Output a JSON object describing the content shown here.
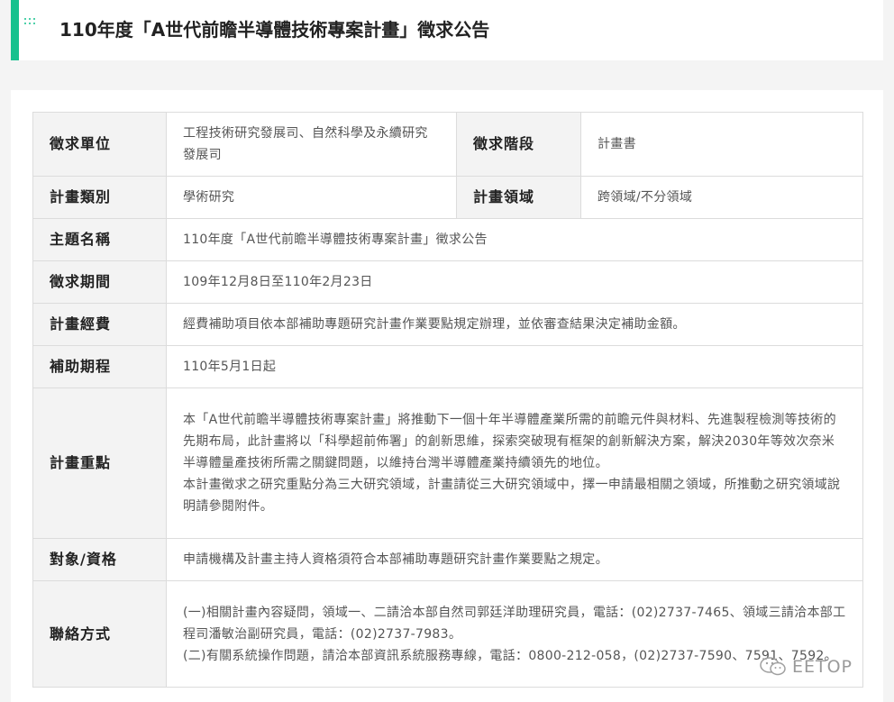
{
  "header": {
    "title": "110年度「A世代前瞻半導體技術專案計畫」徵求公告",
    "accent_color": "#16c18e",
    "icon": "dots-grid-icon"
  },
  "table": {
    "unit_label": "徵求單位",
    "unit_value": "工程技術研究發展司、自然科學及永續研究發展司",
    "stage_label": "徵求階段",
    "stage_value": "計畫書",
    "category_label": "計畫類別",
    "category_value": "學術研究",
    "field_label": "計畫領域",
    "field_value": "跨領域/不分領域",
    "topic_label": "主題名稱",
    "topic_value": "110年度「A世代前瞻半導體技術專案計畫」徵求公告",
    "period_label": "徵求期間",
    "period_value": "109年12月8日至110年2月23日",
    "budget_label": "計畫經費",
    "budget_value": "經費補助項目依本部補助專題研究計畫作業要點規定辦理，並依審查結果決定補助金額。",
    "term_label": "補助期程",
    "term_value": "110年5月1日起",
    "focus_label": "計畫重點",
    "focus_p1": "本「A世代前瞻半導體技術專案計畫」將推動下一個十年半導體產業所需的前瞻元件與材料、先進製程檢測等技術的先期布局，此計畫將以「科學超前佈署」的創新思維，探索突破現有框架的創新解決方案，解決2030年等效次奈米半導體量產技術所需之關鍵問題，以維持台灣半導體產業持續領先的地位。",
    "focus_p2": "本計畫徵求之研究重點分為三大研究領域，計畫請從三大研究領域中，擇一申請最相關之領域，所推動之研究領域說明請參閱附件。",
    "eligibility_label": "對象/資格",
    "eligibility_value": "申請機構及計畫主持人資格須符合本部補助專題研究計畫作業要點之規定。",
    "contact_label": "聯絡方式",
    "contact_p1": "(一)相關計畫內容疑問，領域一、二請洽本部自然司郭廷洋助理研究員，電話：(02)2737-7465、領域三請洽本部工程司潘敏治副研究員，電話：(02)2737-7983。",
    "contact_p2": "(二)有關系統操作問題，請洽本部資訊系統服務專線，電話：0800-212-058，(02)2737-7590、7591、7592。"
  },
  "watermark": {
    "text": "EETOP",
    "icon": "wechat-icon"
  }
}
